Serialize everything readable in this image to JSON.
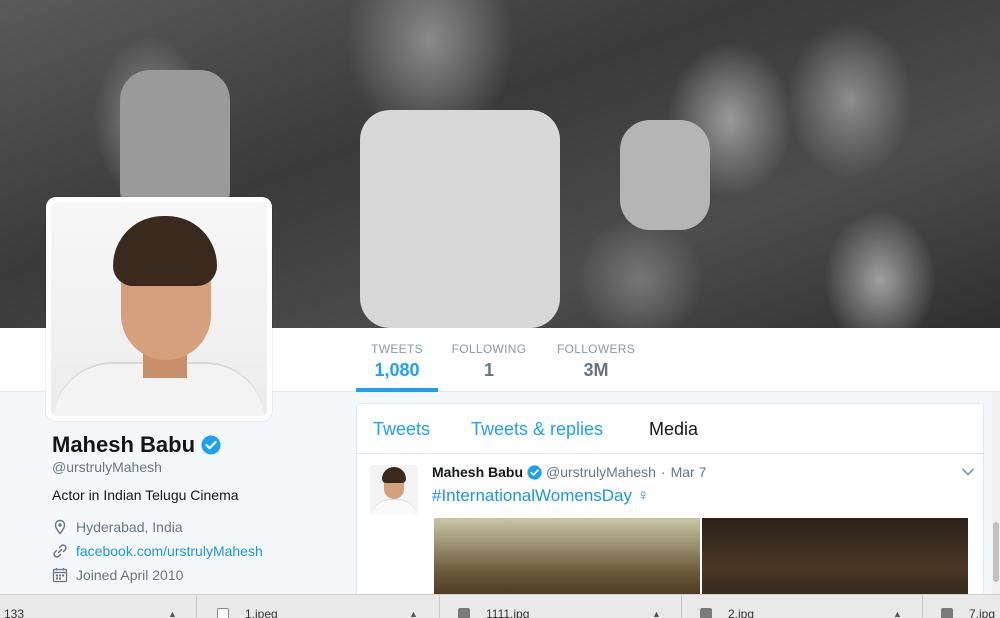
{
  "profile": {
    "name": "Mahesh Babu",
    "handle": "@urstrulyMahesh",
    "bio": "Actor in Indian Telugu Cinema",
    "location": "Hyderabad, India",
    "url": "facebook.com/urstrulyMahesh",
    "joined": "Joined April 2010"
  },
  "stats": [
    {
      "label": "TWEETS",
      "value": "1,080",
      "active": true
    },
    {
      "label": "FOLLOWING",
      "value": "1",
      "active": false
    },
    {
      "label": "FOLLOWERS",
      "value": "3M",
      "active": false
    }
  ],
  "timeline": {
    "tabs": [
      "Tweets",
      "Tweets & replies",
      "Media"
    ],
    "tweet": {
      "name": "Mahesh Babu",
      "handle": "@urstrulyMahesh",
      "separator": "·",
      "date": "Mar 7",
      "text": "#InternationalWomensDay",
      "symbol": "♀"
    }
  },
  "colors": {
    "accent": "#1da1f2",
    "link": "#1b95e0",
    "verified": "#1da1f2"
  },
  "downloads": [
    {
      "text": "133",
      "icon": "file-icon"
    },
    {
      "text": "1.jpeg",
      "icon": "file-icon"
    },
    {
      "text": "1111.jpg",
      "icon": "package-icon"
    },
    {
      "text": "2.jpg",
      "icon": "package-icon"
    },
    {
      "text": "7.jpg",
      "icon": "package-icon"
    }
  ]
}
